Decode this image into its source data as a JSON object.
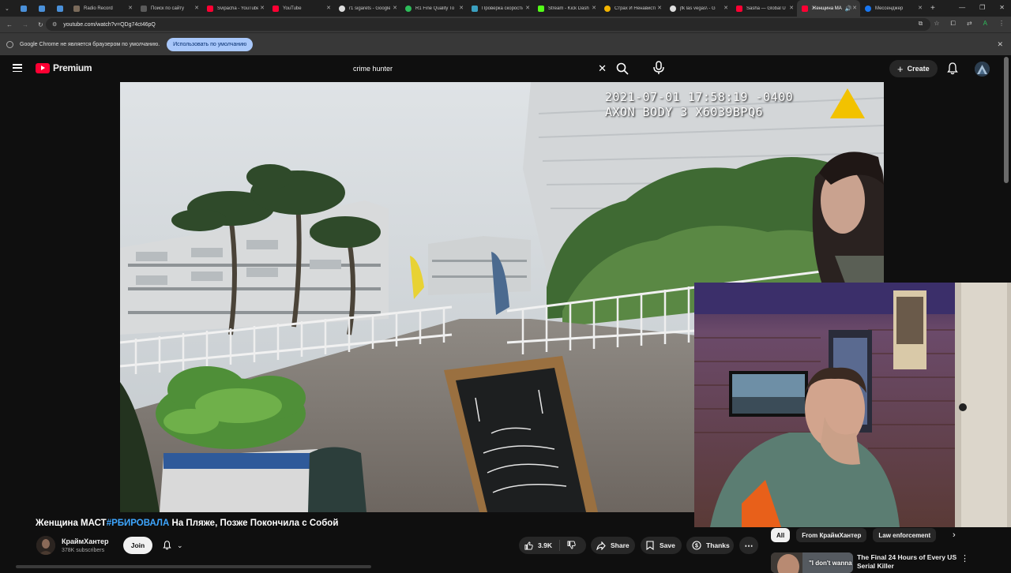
{
  "browser": {
    "tabs": [
      {
        "label": "",
        "color": "#4a90d9"
      },
      {
        "label": "",
        "color": "#4a90d9"
      },
      {
        "label": "",
        "color": "#4a90d9"
      },
      {
        "label": "Radio Record",
        "color": "#7a6a5a"
      },
      {
        "label": "Поиск по сайту",
        "color": "#5a5a5a"
      },
      {
        "label": "Svipacha - YouTube",
        "color": "#ff0033"
      },
      {
        "label": "YouTube",
        "color": "#ff0033"
      },
      {
        "label": "r1 sigarets - Google",
        "color": "#dddddd"
      },
      {
        "label": "R1 Fine Quality To",
        "color": "#2dbd5a"
      },
      {
        "label": "Проверка скорости",
        "color": "#3aa0c0"
      },
      {
        "label": "Stream - Kick Dash",
        "color": "#53fc18"
      },
      {
        "label": "Страх И Ненависть",
        "color": "#f2b400"
      },
      {
        "label": "jfk las vegas\\ - G",
        "color": "#dddddd"
      },
      {
        "label": "Sasha — Global U",
        "color": "#ff0033"
      },
      {
        "label": "Женщина МА",
        "color": "#ff0033",
        "active": true
      },
      {
        "label": "Мессенджер",
        "color": "#1877f2"
      }
    ],
    "url": "youtube.com/watch?v=QDg74ct46pQ",
    "infobar_text": "Google Chrome не является браузером по умолчанию.",
    "infobar_button": "Использовать по умолчанию"
  },
  "header": {
    "logo_label": "Premium",
    "search_value": "crime hunter",
    "create_label": "Create"
  },
  "video": {
    "timestamp_line1": "2021-07-01 17:58:19 -0400",
    "timestamp_line2": "AXON BODY 3 X6039BPQ6",
    "title_prefix": "Женщина МАСТ",
    "title_tag": "#РБИРОВАЛА",
    "title_suffix": " На Пляже, Позже Покончила с Собой"
  },
  "channel": {
    "name": "КраймХантер",
    "subscribers": "378K subscribers",
    "join_label": "Join"
  },
  "actions": {
    "likes": "3.9K",
    "share": "Share",
    "save": "Save",
    "thanks": "Thanks"
  },
  "chips": [
    "All",
    "From КраймХантер",
    "Law enforcement"
  ],
  "recommendation": {
    "thumb_quote": "\"I don't wanna",
    "title": "The Final 24 Hours of Every US Serial Killer"
  },
  "colors": {
    "accent": "#ff0033",
    "link": "#3ea6ff",
    "background": "#0f0f0f"
  }
}
